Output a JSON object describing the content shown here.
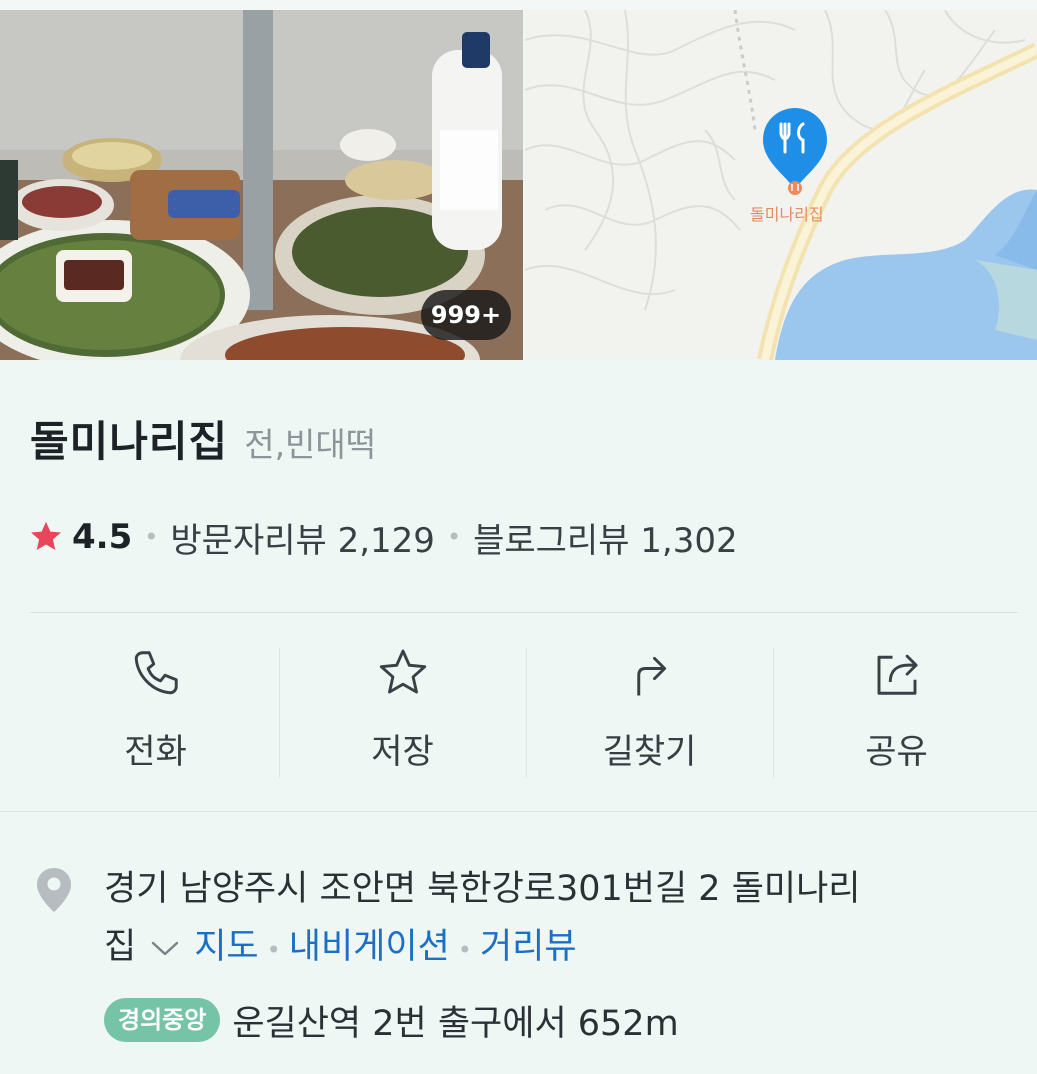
{
  "gallery": {
    "photo_count": "999+",
    "map_pin_label": "돌미나리집"
  },
  "place": {
    "name": "돌미나리집",
    "category": "전,빈대떡"
  },
  "reviews": {
    "rating": "4.5",
    "visitor_reviews": "방문자리뷰 2,129",
    "blog_reviews": "블로그리뷰 1,302"
  },
  "actions": [
    {
      "label": "전화",
      "icon": "phone-icon"
    },
    {
      "label": "저장",
      "icon": "star-outline-icon"
    },
    {
      "label": "길찾기",
      "icon": "directions-icon"
    },
    {
      "label": "공유",
      "icon": "share-icon"
    }
  ],
  "address": {
    "text_line1": "경기 남양주시 조안면 북한강로301번길 2 돌미나리",
    "text_line2": "집",
    "links": [
      "지도",
      "내비게이션",
      "거리뷰"
    ]
  },
  "transit": {
    "line_name": "경의중앙",
    "line_color": "#76c4a8",
    "directions": "운길산역 2번 출구에서 652m"
  },
  "colors": {
    "accent_star": "#e8465b",
    "link": "#1b6fc4",
    "map_pin": "#1f8ee6"
  }
}
